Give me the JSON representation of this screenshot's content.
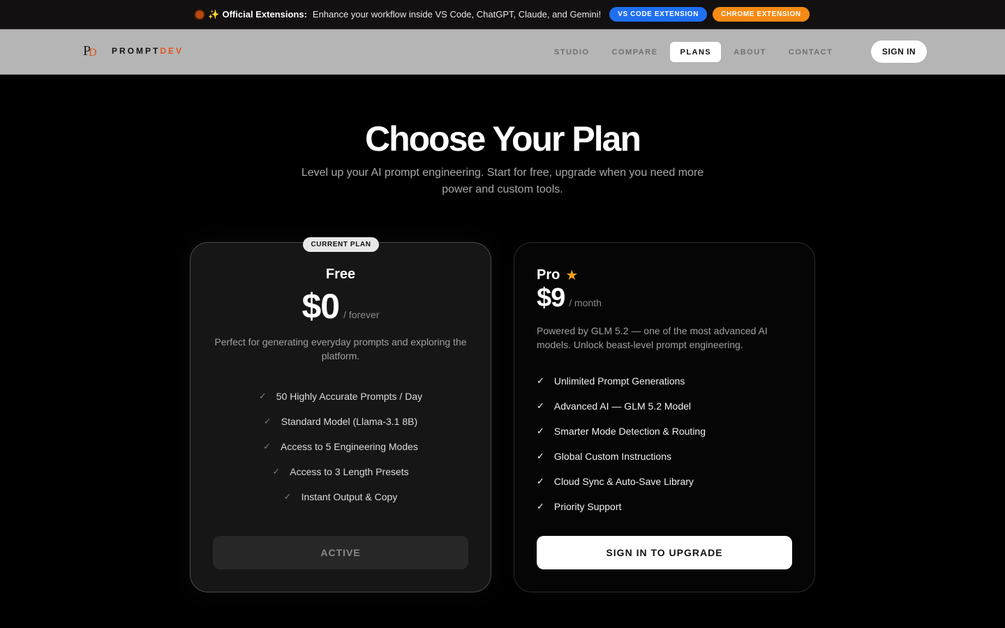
{
  "announcement": {
    "dot_color": "#b8480f",
    "sparkle": "✨",
    "label": "Official Extensions:",
    "message": "Enhance your workflow inside VS Code, ChatGPT, Claude, and Gemini!",
    "vscode_button": "VS CODE EXTENSION",
    "chrome_button": "CHROME EXTENSION"
  },
  "nav": {
    "logo_p": "P",
    "logo_d": "D",
    "brand_main": "PROMPT",
    "brand_accent": "DEV",
    "links": [
      "STUDIO",
      "COMPARE",
      "PLANS",
      "ABOUT",
      "CONTACT"
    ],
    "active_link": "PLANS",
    "sign_in": "SIGN IN"
  },
  "hero": {
    "title": "Choose Your Plan",
    "subtitle": "Level up your AI prompt engineering. Start for free, upgrade when you need more power and custom tools."
  },
  "plans": {
    "free": {
      "badge": "CURRENT PLAN",
      "name": "Free",
      "price": "$0",
      "period": "/ forever",
      "description": "Perfect for generating everyday prompts and exploring the platform.",
      "check_icon": "✓",
      "features": [
        "50 Highly Accurate Prompts / Day",
        "Standard Model (Llama-3.1 8B)",
        "Access to 5 Engineering Modes",
        "Access to 3 Length Presets",
        "Instant Output & Copy"
      ],
      "button": "ACTIVE"
    },
    "pro": {
      "name": "Pro",
      "star_icon": "★",
      "price": "$9",
      "period": "/ month",
      "description": "Powered by GLM 5.2 — one of the most advanced AI models. Unlock beast-level prompt engineering.",
      "check_icon": "✓",
      "features": [
        "Unlimited Prompt Generations",
        "Advanced AI — GLM 5.2 Model",
        "Smarter Mode Detection & Routing",
        "Global Custom Instructions",
        "Cloud Sync & Auto-Save Library",
        "Priority Support"
      ],
      "button": "SIGN IN TO UPGRADE"
    }
  },
  "colors": {
    "accent_orange": "#e2531d",
    "vscode_blue": "#1f6ff0",
    "chrome_orange": "#f58a14",
    "star": "#f7a21b"
  }
}
